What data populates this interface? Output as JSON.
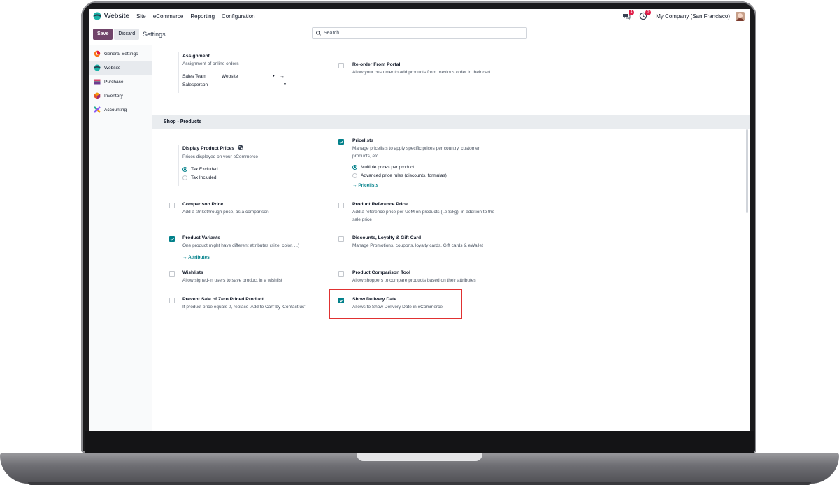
{
  "topbar": {
    "app_name": "Website",
    "menu": [
      "Site",
      "eCommerce",
      "Reporting",
      "Configuration"
    ],
    "chat_badge": "4",
    "activity_badge": "2",
    "company": "My Company (San Francisco)"
  },
  "control_panel": {
    "save_label": "Save",
    "discard_label": "Discard",
    "title": "Settings",
    "search_placeholder": "Search..."
  },
  "sidebar": {
    "items": [
      {
        "label": "General Settings",
        "color": "#f97316"
      },
      {
        "label": "Website",
        "color": "#1ab3a8"
      },
      {
        "label": "Purchase",
        "color": "#d9466d"
      },
      {
        "label": "Inventory",
        "color": "#e5532f"
      },
      {
        "label": "Accounting",
        "color": "#8b5cf6"
      }
    ]
  },
  "settings": {
    "assignment": {
      "title": "Assignment",
      "desc": "Assignment of online orders",
      "sales_team_label": "Sales Team",
      "sales_team_value": "Website",
      "salesperson_label": "Salesperson"
    },
    "reorder": {
      "title": "Re-order From Portal",
      "desc": "Allow your customer to add products from previous order in their cart."
    },
    "section_title": "Shop - Products",
    "display_prices": {
      "title": "Display Product Prices",
      "desc": "Prices displayed on your eCommerce",
      "opt1": "Tax Excluded",
      "opt2": "Tax Included"
    },
    "pricelists": {
      "title": "Pricelists",
      "desc": "Manage pricelists to apply specific prices per country, customer, products, etc",
      "opt1": "Multiple prices per product",
      "opt2": "Advanced price rules (discounts, formulas)",
      "link": "Pricelists"
    },
    "comparison_price": {
      "title": "Comparison Price",
      "desc": "Add a strikethrough price, as a comparison"
    },
    "reference_price": {
      "title": "Product Reference Price",
      "desc": "Add a reference price per UoM on products (i.e $/kg), in addition to the sale price"
    },
    "variants": {
      "title": "Product Variants",
      "desc": "One product might have different attributes (size, color, ...)",
      "link": "Attributes"
    },
    "discounts": {
      "title": "Discounts, Loyalty & Gift Card",
      "desc": "Manage Promotions, coupons, loyalty cards, Gift cards & eWallet"
    },
    "wishlists": {
      "title": "Wishlists",
      "desc": "Allow signed-in users to save product in a wishlist"
    },
    "comparison_tool": {
      "title": "Product Comparison Tool",
      "desc": "Allow shoppers to compare products based on their attributes"
    },
    "zero_price": {
      "title": "Prevent Sale of Zero Priced Product",
      "desc": "If product price equals 0, replace 'Add to Cart' by 'Contact us'."
    },
    "delivery_date": {
      "title": "Show Delivery Date",
      "desc": "Allows to Show Delivery Date in eCommerce"
    }
  },
  "colors": {
    "primary": "#71456a",
    "accent": "#01808a",
    "highlight": "#e03131"
  }
}
